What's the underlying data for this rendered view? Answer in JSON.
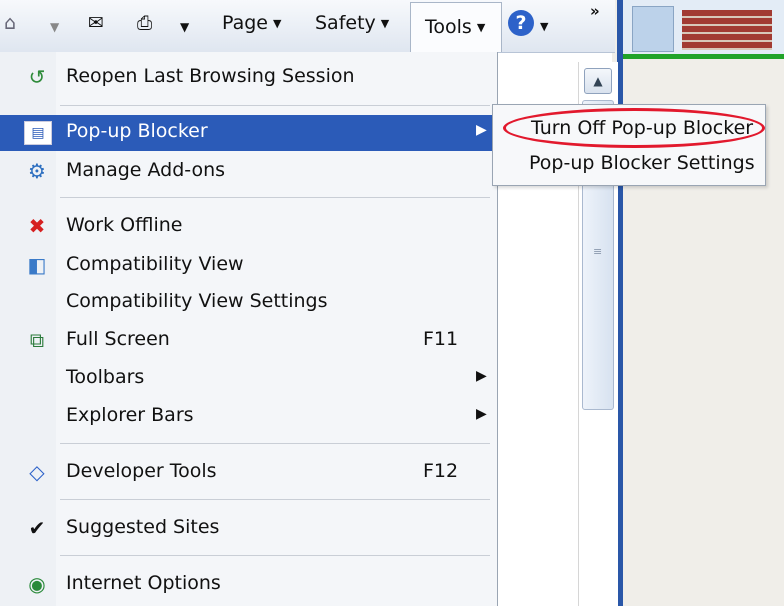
{
  "toolbar": {
    "page_label": "Page",
    "safety_label": "Safety",
    "tools_label": "Tools",
    "more_chevron": "»",
    "icons": [
      "rss-icon",
      "mail-icon",
      "print-icon",
      "help-icon"
    ]
  },
  "menu": {
    "items": [
      {
        "label": "Reopen Last Browsing Session",
        "icon": "reopen-session-icon"
      },
      {
        "label": "Pop-up Blocker",
        "icon": "popup-blocker-icon",
        "highlighted": true,
        "submenu": true
      },
      {
        "label": "Manage Add-ons",
        "icon": "add-ons-icon"
      },
      {
        "label": "Work Offline",
        "icon": "work-offline-icon"
      },
      {
        "label": "Compatibility View",
        "icon": "compatibility-view-icon"
      },
      {
        "label": "Compatibility View Settings"
      },
      {
        "label": "Full Screen",
        "icon": "full-screen-icon",
        "shortcut": "F11"
      },
      {
        "label": "Toolbars",
        "submenu": true
      },
      {
        "label": "Explorer Bars",
        "submenu": true
      },
      {
        "label": "Developer Tools",
        "icon": "developer-tools-icon",
        "shortcut": "F12"
      },
      {
        "label": "Suggested Sites",
        "checked": true
      },
      {
        "label": "Internet Options",
        "icon": "internet-options-icon"
      }
    ]
  },
  "submenu": {
    "items": [
      "Turn Off Pop-up Blocker",
      "Pop-up Blocker Settings"
    ]
  },
  "colors": {
    "highlight": "#2b5bb8",
    "annotation_circle": "#e2192d",
    "frame_blue": "#2a57a8",
    "green_line": "#21a329"
  }
}
